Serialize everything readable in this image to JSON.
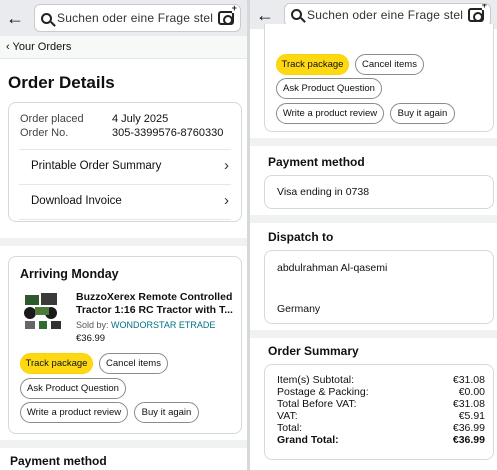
{
  "header": {
    "search_placeholder": "Suchen oder eine Frage stel...",
    "search_placeholder_right": "Suchen oder eine Frage stel..."
  },
  "breadcrumb": "‹ Your Orders",
  "page_title": "Order Details",
  "order": {
    "placed_label": "Order placed",
    "placed_value": "4 July 2025",
    "no_label": "Order No.",
    "no_value": "305-3399576-8760330",
    "printable_summary": "Printable Order Summary",
    "download_invoice": "Download Invoice"
  },
  "shipment": {
    "arriving": "Arriving Monday",
    "title_line1": "BuzzoXerex Remote Controlled",
    "title_line2": "Tractor 1:16 RC Tractor with T...",
    "sold_by_label": "Sold by:",
    "sold_by": "WONDORSTAR ETRADE",
    "price": "€36.99",
    "buttons": {
      "track": "Track package",
      "cancel": "Cancel items",
      "question": "Ask Product Question",
      "review": "Write a product review",
      "buy_again": "Buy it again"
    }
  },
  "payment": {
    "title": "Payment method",
    "card": "Visa ending in 0738"
  },
  "dispatch": {
    "title": "Dispatch to",
    "name": "abdulrahman Al-qasemi",
    "country": "Germany"
  },
  "summary": {
    "title": "Order Summary",
    "rows": [
      {
        "label": "Item(s) Subtotal:",
        "value": "€31.08"
      },
      {
        "label": "Postage & Packing:",
        "value": "€0.00"
      },
      {
        "label": "Total Before VAT:",
        "value": "€31.08"
      },
      {
        "label": "VAT:",
        "value": "€5.91"
      },
      {
        "label": "Total:",
        "value": "€36.99"
      },
      {
        "label": "Grand Total:",
        "value": "€36.99"
      }
    ]
  }
}
